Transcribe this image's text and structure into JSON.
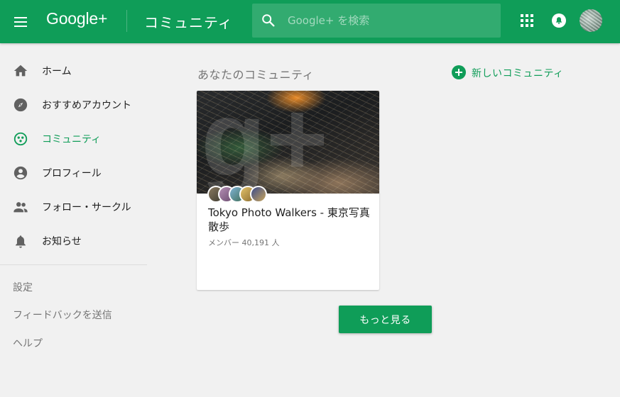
{
  "colors": {
    "brand_green": "#0f9d58",
    "background": "#f1f1f1"
  },
  "header": {
    "menu_icon": "hamburger-icon",
    "logo": "Google+",
    "title": "コミュニティ",
    "search": {
      "placeholder": "Google+ を検索",
      "value": "",
      "icon": "search-icon"
    },
    "apps_icon": "grid-icon",
    "notifications_icon": "bell-icon",
    "avatar_icon": "profile-avatar"
  },
  "sidebar": {
    "items": [
      {
        "label": "ホーム",
        "icon": "home-icon"
      },
      {
        "label": "おすすめアカウント",
        "icon": "compass-icon"
      },
      {
        "label": "コミュニティ",
        "icon": "communities-icon",
        "active": true
      },
      {
        "label": "プロフィール",
        "icon": "person-icon"
      },
      {
        "label": "フォロー・サークル",
        "icon": "people-icon"
      },
      {
        "label": "お知らせ",
        "icon": "bell-icon"
      }
    ],
    "links": [
      "設定",
      "フィードバックを送信",
      "ヘルプ"
    ]
  },
  "main": {
    "section_title": "あなたのコミュニティ",
    "new_community_label": "新しいコミュニティ",
    "communities": [
      {
        "name": "Tokyo Photo Walkers - 東京写真散歩",
        "members": "メンバー 40,191 人"
      }
    ],
    "more_button": "もっと見る"
  }
}
